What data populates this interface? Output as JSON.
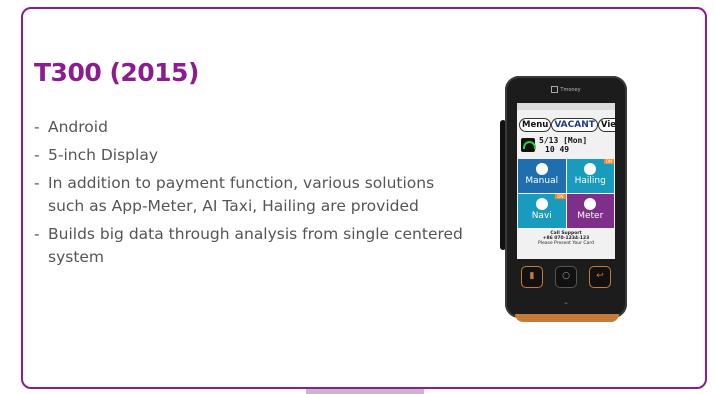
{
  "slide": {
    "title": "T300 (2015)",
    "bullets": [
      "Android",
      "5-inch Display",
      "In addition to payment function, various solutions such as App-Meter, AI Taxi, Hailing are provided",
      "Builds big data through analysis from single centered system"
    ]
  },
  "device": {
    "brand": "Tmoney",
    "screen": {
      "menu_label": "Menu",
      "status_label": "VACANT",
      "view_label": "View",
      "date_line": "5/13 [Mon]",
      "time_line": "10 49",
      "tiles": [
        {
          "label": "Manual",
          "on": ""
        },
        {
          "label": "Hailing",
          "on": "ON"
        },
        {
          "label": "Navi",
          "on": "ON"
        },
        {
          "label": "Meter",
          "on": ""
        }
      ],
      "support_title": "Call Support",
      "support_phone": "+86 070-1234-123",
      "card_text": "Please Present Your Card"
    }
  },
  "colors": {
    "accent": "#8b1d8e",
    "tile_blue": "#1f6fae",
    "tile_teal": "#199bbd",
    "tile_purple": "#7e2f89",
    "device_orange": "#c87a3a"
  }
}
